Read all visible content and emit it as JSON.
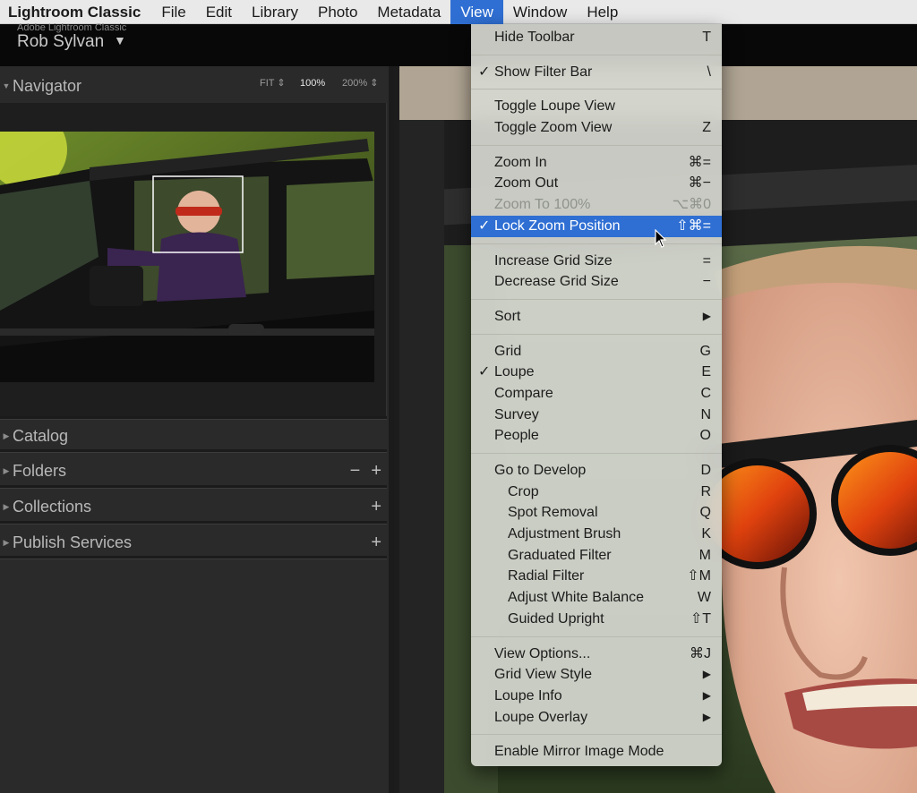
{
  "menubar": {
    "app": "Lightroom Classic",
    "items": [
      "File",
      "Edit",
      "Library",
      "Photo",
      "Metadata",
      "View",
      "Window",
      "Help"
    ],
    "active": "View",
    "active_color": "#2f6fd3"
  },
  "identity": {
    "small": "Adobe Lightroom Classic",
    "name": "Rob Sylvan",
    "caret": "▼"
  },
  "navigator": {
    "title": "Navigator",
    "zoom_options": [
      {
        "label": "FIT ⇕",
        "selected": false
      },
      {
        "label": "100%",
        "selected": true
      },
      {
        "label": "200% ⇕",
        "selected": false
      }
    ]
  },
  "panels": [
    {
      "title": "Catalog",
      "actions": []
    },
    {
      "title": "Folders",
      "actions": [
        "−",
        "+"
      ]
    },
    {
      "title": "Collections",
      "actions": [
        "+"
      ]
    },
    {
      "title": "Publish Services",
      "actions": [
        "+"
      ]
    }
  ],
  "view_menu": [
    {
      "label": "Hide Toolbar",
      "shortcut": "T"
    },
    {
      "divider": true
    },
    {
      "label": "Show Filter Bar",
      "shortcut": "\\",
      "checked": true
    },
    {
      "divider": true
    },
    {
      "label": "Toggle Loupe View",
      "shortcut": ""
    },
    {
      "label": "Toggle Zoom View",
      "shortcut": "Z"
    },
    {
      "divider": true
    },
    {
      "label": "Zoom In",
      "shortcut": "⌘="
    },
    {
      "label": "Zoom Out",
      "shortcut": "⌘−"
    },
    {
      "label": "Zoom To 100%",
      "shortcut": "⌥⌘0",
      "disabled": true
    },
    {
      "label": "Lock Zoom Position",
      "shortcut": "⇧⌘=",
      "checked": true,
      "highlighted": true
    },
    {
      "divider": true
    },
    {
      "label": "Increase Grid Size",
      "shortcut": "="
    },
    {
      "label": "Decrease Grid Size",
      "shortcut": "−"
    },
    {
      "divider": true
    },
    {
      "label": "Sort",
      "shortcut": "▶"
    },
    {
      "divider": true
    },
    {
      "label": "Grid",
      "shortcut": "G"
    },
    {
      "label": "Loupe",
      "shortcut": "E",
      "checked": true
    },
    {
      "label": "Compare",
      "shortcut": "C"
    },
    {
      "label": "Survey",
      "shortcut": "N"
    },
    {
      "label": "People",
      "shortcut": "O"
    },
    {
      "divider": true
    },
    {
      "label": "Go to Develop",
      "shortcut": "D"
    },
    {
      "label": "Crop",
      "shortcut": "R",
      "indent": true
    },
    {
      "label": "Spot Removal",
      "shortcut": "Q",
      "indent": true
    },
    {
      "label": "Adjustment Brush",
      "shortcut": "K",
      "indent": true
    },
    {
      "label": "Graduated Filter",
      "shortcut": "M",
      "indent": true
    },
    {
      "label": "Radial Filter",
      "shortcut": "⇧M",
      "indent": true
    },
    {
      "label": "Adjust White Balance",
      "shortcut": "W",
      "indent": true
    },
    {
      "label": "Guided Upright",
      "shortcut": "⇧T",
      "indent": true
    },
    {
      "divider": true
    },
    {
      "label": "View Options...",
      "shortcut": "⌘J"
    },
    {
      "label": "Grid View Style",
      "shortcut": "▶"
    },
    {
      "label": "Loupe Info",
      "shortcut": "▶"
    },
    {
      "label": "Loupe Overlay",
      "shortcut": "▶"
    },
    {
      "divider": true
    },
    {
      "label": "Enable Mirror Image Mode",
      "shortcut": ""
    }
  ],
  "checkmark": "✓"
}
